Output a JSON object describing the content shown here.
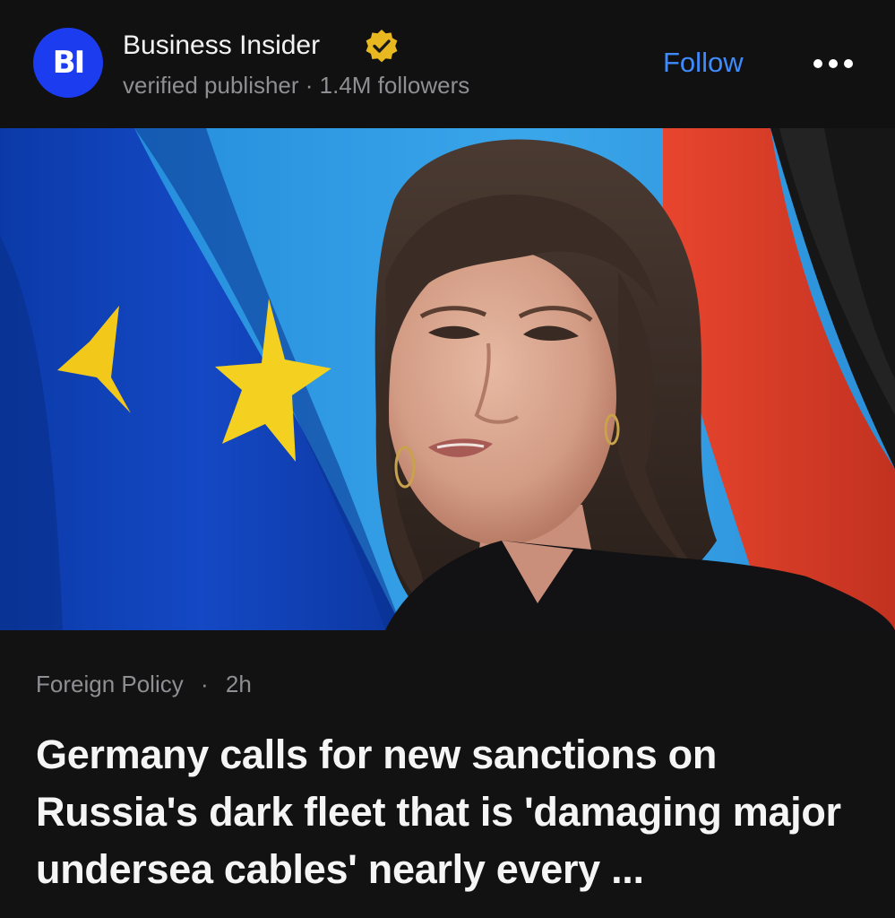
{
  "publisher": {
    "logo_text": "BI",
    "name": "Business Insider",
    "meta": "verified publisher · 1.4M followers",
    "follow_label": "Follow",
    "icons": {
      "verified": "verified-badge-icon",
      "more": "more-options-icon"
    }
  },
  "article": {
    "image_alt": "Woman speaking in front of EU and German flags",
    "category": "Foreign Policy",
    "separator": "·",
    "age": "2h",
    "headline": "Germany calls for new sanctions on Russia's dark fleet that is 'damaging major undersea cables' nearly every ..."
  },
  "colors": {
    "background": "#121212",
    "follow": "#3e8bff",
    "logo": "#1c3cf0",
    "verified_badge": "#e8b820",
    "secondary_text": "#8e8e93"
  }
}
